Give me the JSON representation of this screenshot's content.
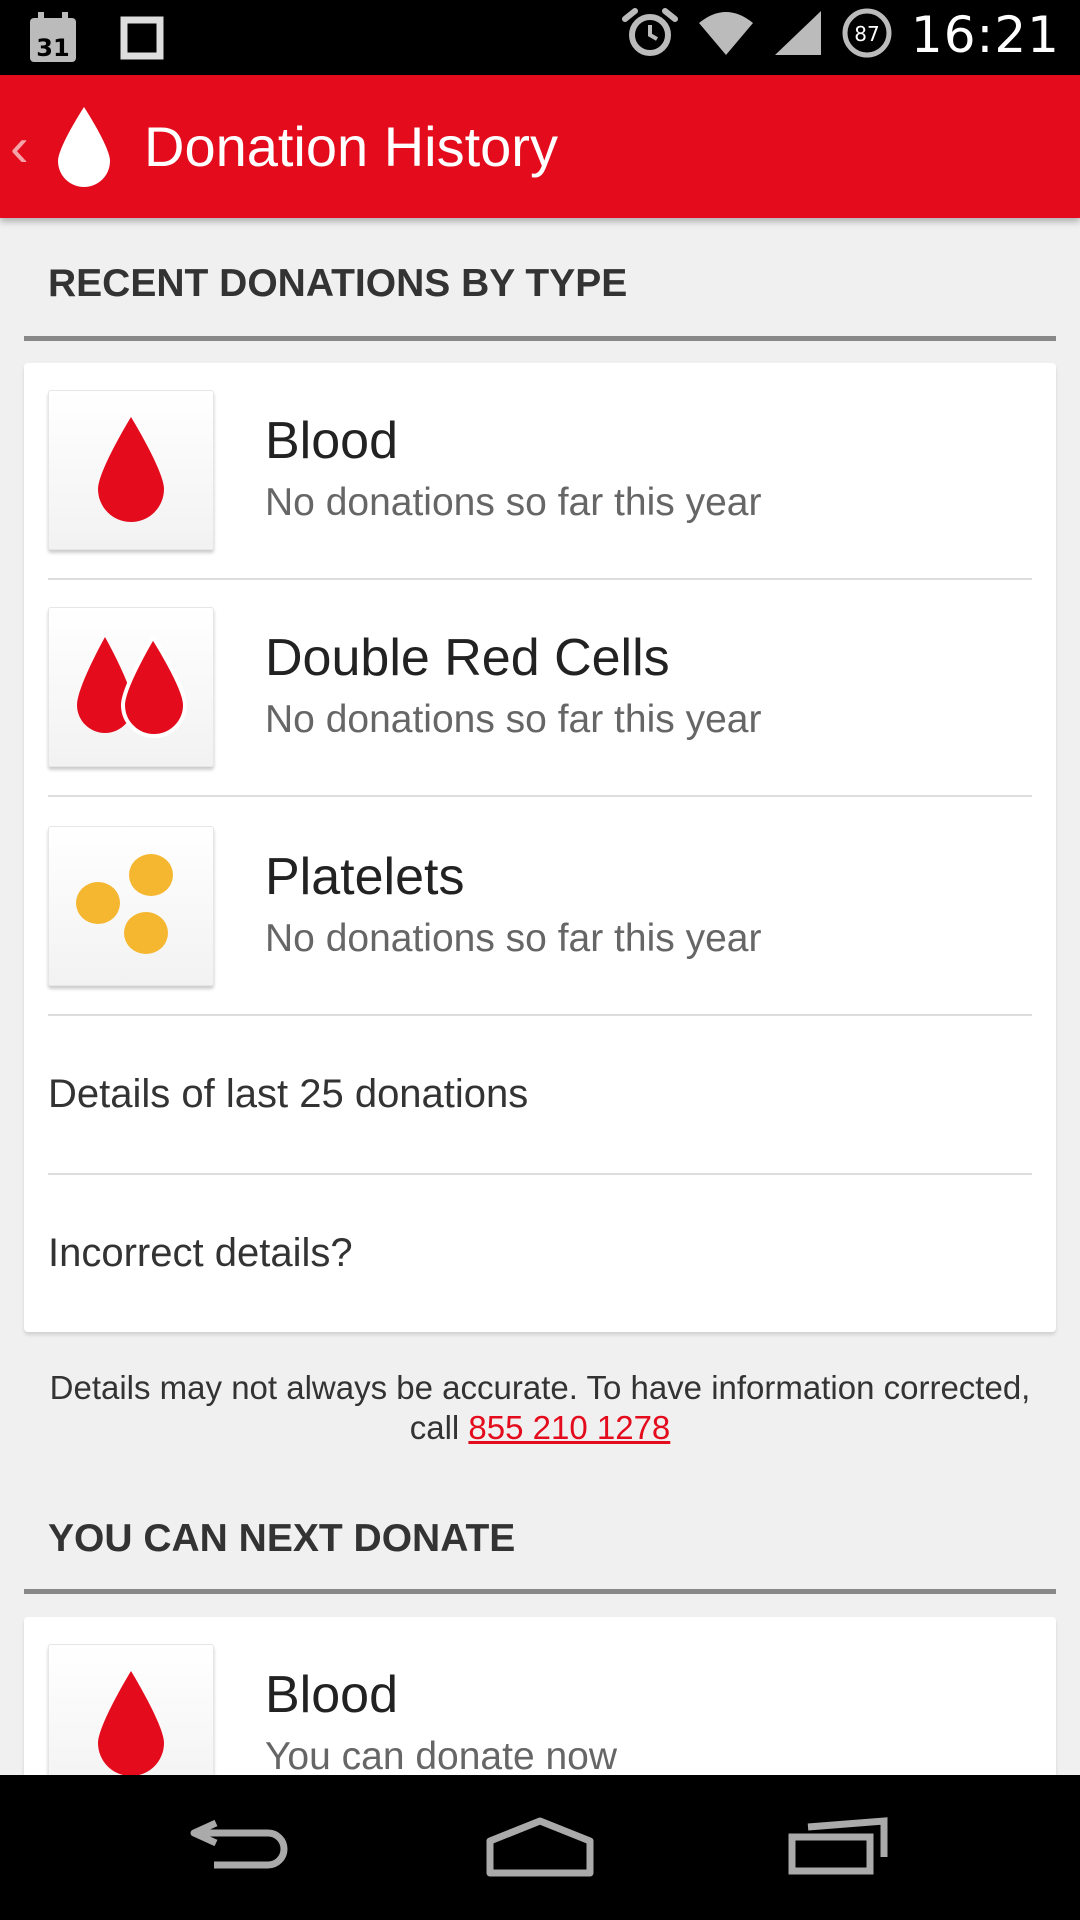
{
  "status_bar": {
    "calendar_day": "31",
    "battery_level": "87",
    "time": "16:21",
    "icons": [
      "calendar-icon",
      "square-icon",
      "alarm-icon",
      "wifi-icon",
      "signal-icon",
      "battery-icon"
    ]
  },
  "app_bar": {
    "title": "Donation History",
    "color": "#e30b1c"
  },
  "recent": {
    "header": "RECENT DONATIONS BY TYPE",
    "items": [
      {
        "title": "Blood",
        "subtitle": "No donations so far this year",
        "icon": "blood-drop-icon"
      },
      {
        "title": "Double Red Cells",
        "subtitle": "No donations so far this year",
        "icon": "double-drop-icon"
      },
      {
        "title": "Platelets",
        "subtitle": "No donations so far this year",
        "icon": "platelets-icon"
      }
    ],
    "links": [
      {
        "label": "Details of last 25 donations"
      },
      {
        "label": "Incorrect details?"
      }
    ]
  },
  "footnote": {
    "line1": "Details may not always be accurate. To have information corrected,",
    "call_prefix": "call ",
    "phone": "855 210 1278"
  },
  "next": {
    "header": "YOU CAN NEXT DONATE",
    "items": [
      {
        "title": "Blood",
        "subtitle": "You can donate now",
        "icon": "blood-drop-icon"
      }
    ]
  },
  "colors": {
    "blood_red": "#e30b1c",
    "platelet_yellow": "#f5b630"
  }
}
